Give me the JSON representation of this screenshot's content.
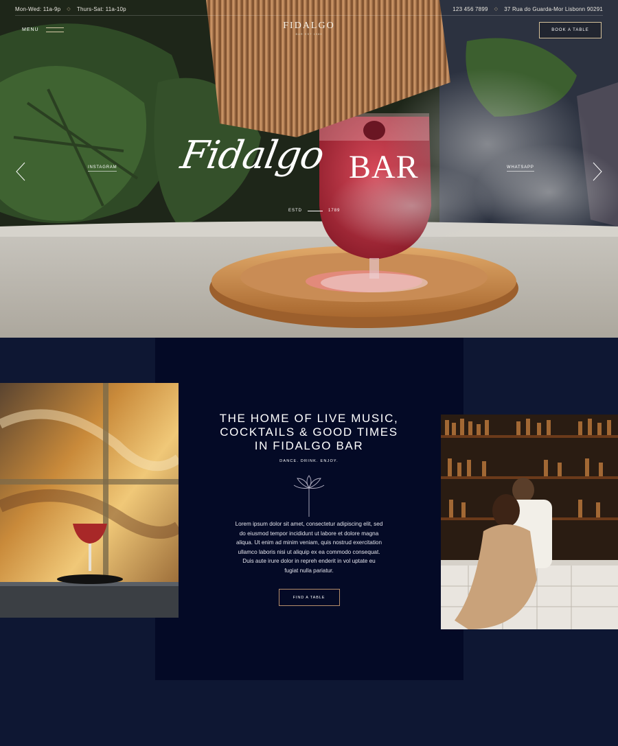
{
  "topbar": {
    "hours_weekday": "Mon-Wed: 11a-9p",
    "hours_weekend": "Thurs-Sat: 11a-10p",
    "phone": "123 456 7899",
    "address": "37 Rua do Guarda-Mor Lisbonn 90291"
  },
  "header": {
    "menu_label": "MENU",
    "logo_name": "FIDALGO",
    "logo_sub": "BAR EST 1989",
    "book_label": "BOOK A TABLE"
  },
  "hero": {
    "title_script": "Fidalgo",
    "title_bar": "BAR",
    "estd_label": "ESTD",
    "estd_year": "1789",
    "left_link": "INSTAGRAM",
    "right_link": "WHATSAPP"
  },
  "intro": {
    "headline_1": "THE HOME OF LIVE MUSIC,",
    "headline_2": "COCKTAILS & GOOD TIMES",
    "headline_3": "IN FIDALGO BAR",
    "tagline": "DANCE. DRINK. ENJOY.",
    "body": "Lorem ipsum dolor sit amet, consectetur adipiscing elit, sed do eiusmod tempor incididunt ut labore et dolore magna aliqua. Ut enim ad minim veniam, quis nostrud exercitation ullamco laboris nisi ut aliquip ex ea commodo consequat. Duis aute irure dolor in repreh enderit in vol uptate eu fugiat nulla pariatur.",
    "button_label": "FIND A TABLE"
  },
  "icons": {
    "separator": "diamond-icon",
    "arrow_left": "chevron-left-icon",
    "arrow_right": "chevron-right-icon",
    "emblem": "lotus-icon",
    "menu": "hamburger-icon"
  },
  "colors": {
    "page_bg": "#0e1733",
    "panel_bg": "#040a26",
    "accent_gold": "#d6c29b",
    "button_border": "#b78f6b"
  }
}
